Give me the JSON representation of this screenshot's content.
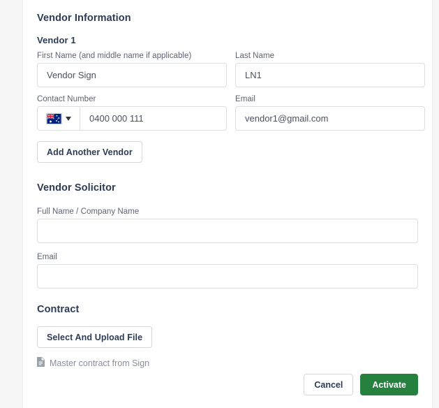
{
  "layout": {
    "card_bg": "#ffffff",
    "page_bg": "#f6f6f7",
    "heading_color": "#2d3b55",
    "label_color": "#5c6373",
    "border_color": "#dcdde1",
    "accent_green": "#26813f"
  },
  "vendor_information": {
    "section_title": "Vendor Information",
    "vendor_label": "Vendor 1",
    "first_name": {
      "label": "First Name (and middle name if applicable)",
      "value": "Vendor Sign",
      "placeholder": ""
    },
    "last_name": {
      "label": "Last Name",
      "value": "LN1",
      "placeholder": ""
    },
    "contact_number": {
      "label": "Contact Number",
      "value": "0400 000 111",
      "placeholder": "",
      "country_flag": "australia-flag",
      "dropdown_icon": "chevron-down-icon"
    },
    "email": {
      "label": "Email",
      "value": "vendor1@gmail.com",
      "placeholder": ""
    },
    "add_vendor_label": "Add Another Vendor"
  },
  "vendor_solicitor": {
    "section_title": "Vendor Solicitor",
    "full_name": {
      "label": "Full Name / Company Name",
      "value": "",
      "placeholder": ""
    },
    "email": {
      "label": "Email",
      "value": "",
      "placeholder": ""
    }
  },
  "contract": {
    "section_title": "Contract",
    "upload_button_label": "Select And Upload File",
    "file_icon": "document-file-icon",
    "file_name": "Master contract from Sign"
  },
  "footer": {
    "cancel_label": "Cancel",
    "activate_label": "Activate"
  }
}
